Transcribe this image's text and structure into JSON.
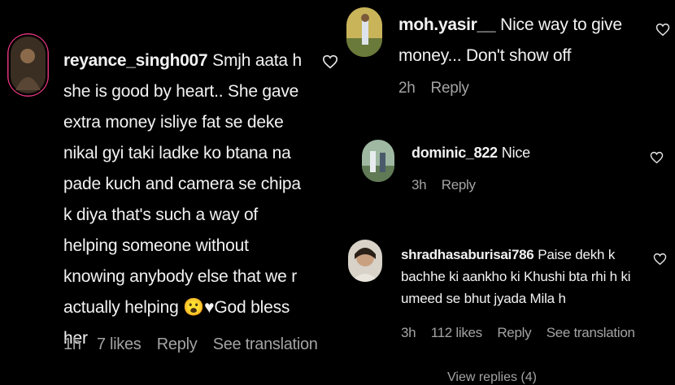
{
  "comments": [
    {
      "username": "reyance_singh007",
      "text": "Smjh aata h she is good by heart.. She gave extra money isliye fat se deke nikal gyi taki ladke ko btana na pade kuch and camera se chipa k diya that's such a way of helping someone without knowing anybody else that we r actually helping 😮♥God bless her",
      "time": "1h",
      "likes": "7 likes",
      "reply": "Reply",
      "translate": "See translation"
    },
    {
      "username": "moh.yasir__",
      "text": "Nice way to give money... Don't show off",
      "time": "2h",
      "reply": "Reply"
    },
    {
      "username": "dominic_822",
      "text": "Nice",
      "time": "3h",
      "reply": "Reply"
    },
    {
      "username": "shradhasaburisai786",
      "text": "Paise dekh k bachhe ki aankho ki Khushi bta rhi h ki umeed se bhut jyada Mila h",
      "time": "3h",
      "likes": "112 likes",
      "reply": "Reply",
      "translate": "See translation"
    }
  ],
  "view_replies": "View replies (4)",
  "icons": {
    "like": "heart-outline-icon"
  }
}
